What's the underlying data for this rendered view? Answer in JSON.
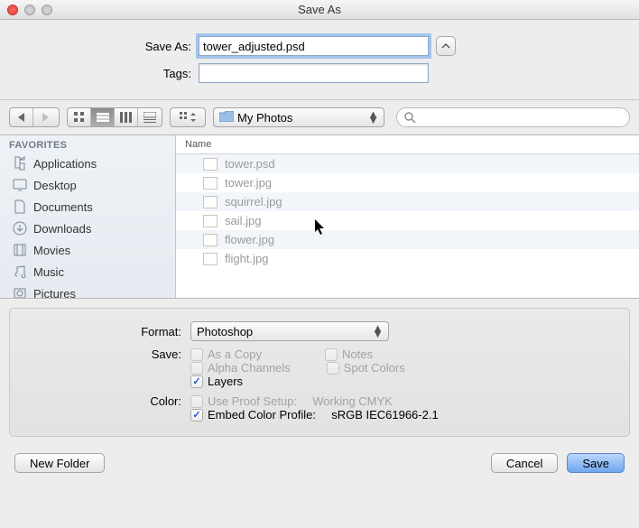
{
  "window": {
    "title": "Save As"
  },
  "form": {
    "save_as_label": "Save As:",
    "save_as_value": "tower_adjusted.psd",
    "tags_label": "Tags:",
    "tags_value": ""
  },
  "toolbar": {
    "location_folder": "My Photos",
    "search_placeholder": ""
  },
  "sidebar": {
    "header": "FAVORITES",
    "items": [
      {
        "label": "Applications",
        "icon": "apps-icon"
      },
      {
        "label": "Desktop",
        "icon": "desktop-icon"
      },
      {
        "label": "Documents",
        "icon": "documents-icon"
      },
      {
        "label": "Downloads",
        "icon": "downloads-icon"
      },
      {
        "label": "Movies",
        "icon": "movies-icon"
      },
      {
        "label": "Music",
        "icon": "music-icon"
      },
      {
        "label": "Pictures",
        "icon": "pictures-icon"
      }
    ]
  },
  "listing": {
    "column_header": "Name",
    "files": [
      {
        "name": "tower.psd"
      },
      {
        "name": "tower.jpg"
      },
      {
        "name": "squirrel.jpg"
      },
      {
        "name": "sail.jpg"
      },
      {
        "name": "flower.jpg"
      },
      {
        "name": "flight.jpg"
      }
    ]
  },
  "options": {
    "format_label": "Format:",
    "format_value": "Photoshop",
    "save_label": "Save:",
    "as_a_copy": "As a Copy",
    "notes": "Notes",
    "alpha_channels": "Alpha Channels",
    "spot_colors": "Spot Colors",
    "layers": "Layers",
    "color_label": "Color:",
    "use_proof_setup": "Use Proof Setup:",
    "proof_value": "Working CMYK",
    "embed_profile": "Embed Color Profile:",
    "profile_value": "sRGB IEC61966-2.1"
  },
  "footer": {
    "new_folder": "New Folder",
    "cancel": "Cancel",
    "save": "Save"
  }
}
